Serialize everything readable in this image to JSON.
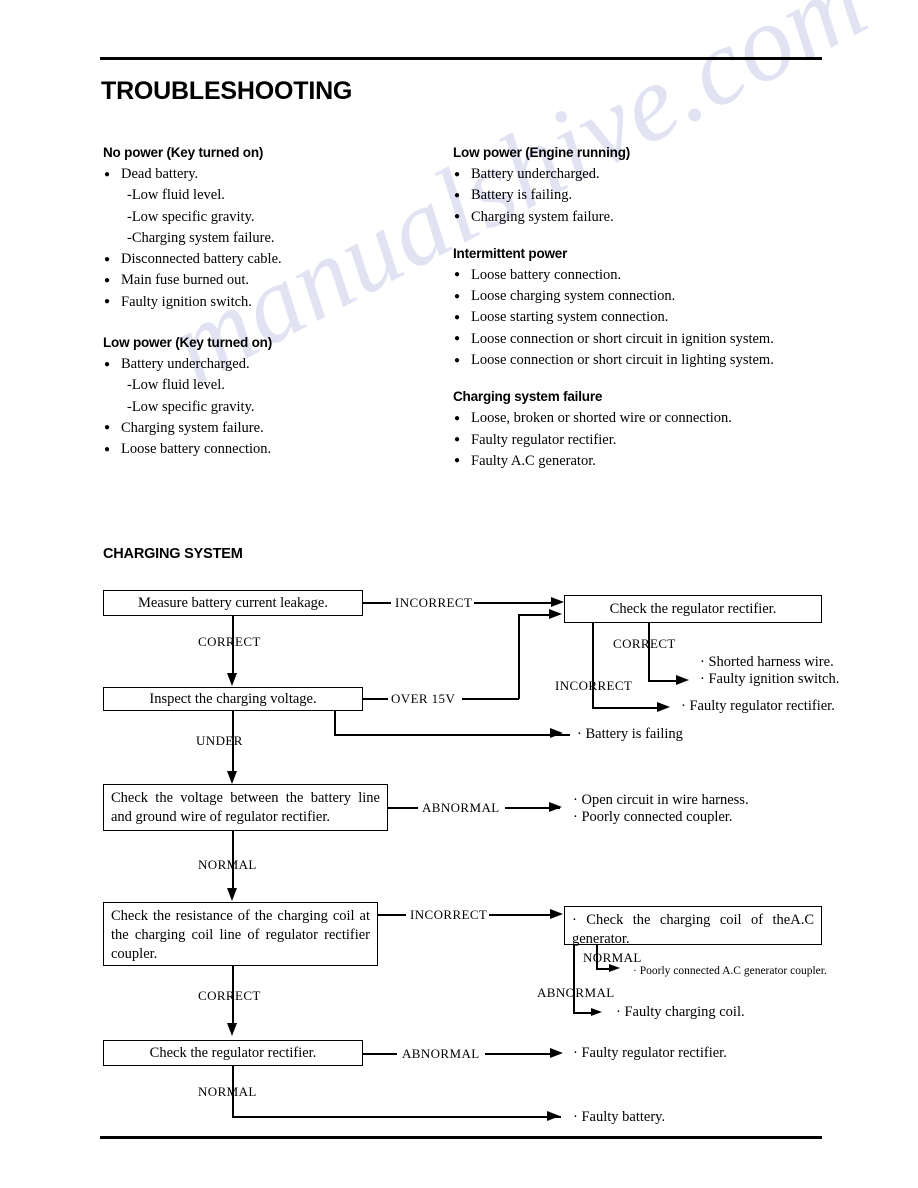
{
  "document": {
    "title": "TROUBLESHOOTING",
    "watermark": "manualshive.com"
  },
  "fault_sections": {
    "left": [
      {
        "heading": "No power (Key turned on)",
        "items": [
          {
            "text": "Dead battery.",
            "style": "bullet"
          },
          {
            "text": "-Low fluid level.",
            "style": "sub"
          },
          {
            "text": "-Low specific gravity.",
            "style": "sub"
          },
          {
            "text": "-Charging system failure.",
            "style": "sub"
          },
          {
            "text": "Disconnected battery cable.",
            "style": "bullet"
          },
          {
            "text": "Main fuse burned out.",
            "style": "bullet"
          },
          {
            "text": "Faulty ignition switch.",
            "style": "bullet"
          }
        ]
      },
      {
        "heading": "Low power (Key turned on)",
        "items": [
          {
            "text": "Battery undercharged.",
            "style": "bullet"
          },
          {
            "text": "-Low fluid level.",
            "style": "sub"
          },
          {
            "text": "-Low specific gravity.",
            "style": "sub"
          },
          {
            "text": "Charging system failure.",
            "style": "bullet"
          },
          {
            "text": "Loose battery connection.",
            "style": "bullet"
          }
        ]
      }
    ],
    "right": [
      {
        "heading": "Low power (Engine running)",
        "items": [
          {
            "text": "Battery undercharged.",
            "style": "bullet"
          },
          {
            "text": "Battery is failing.",
            "style": "bullet"
          },
          {
            "text": "Charging system failure.",
            "style": "bullet"
          }
        ]
      },
      {
        "heading": "Intermittent power",
        "items": [
          {
            "text": "Loose battery connection.",
            "style": "bullet"
          },
          {
            "text": "Loose charging system connection.",
            "style": "bullet"
          },
          {
            "text": "Loose starting system connection.",
            "style": "bullet"
          },
          {
            "text": "Loose connection or short circuit in ignition system.",
            "style": "bullet"
          },
          {
            "text": "Loose connection or short circuit in lighting system.",
            "style": "bullet"
          }
        ]
      },
      {
        "heading": "Charging system failure",
        "items": [
          {
            "text": "Loose, broken or shorted wire or connection.",
            "style": "bullet"
          },
          {
            "text": "Faulty regulator rectifier.",
            "style": "bullet"
          },
          {
            "text": "Faulty A.C generator.",
            "style": "bullet"
          }
        ]
      }
    ]
  },
  "flowchart": {
    "title": "CHARGING SYSTEM",
    "boxes": {
      "measure_leakage": "Measure battery current leakage.",
      "inspect_voltage": "Inspect the charging voltage.",
      "check_regulator_top": "Check the regulator rectifier.",
      "check_voltage_battery_line": "Check the voltage between the battery line and ground wire of regulator rectifier.",
      "check_resistance_coil": "Check the resistance of the charging coil at the charging coil line of regulator rectifier coupler.",
      "check_charging_coil_ac": "Check the charging coil of theA.C generator.",
      "check_regulator_bottom": "Check the regulator rectifier."
    },
    "labels": {
      "incorrect_1": "INCORRECT",
      "correct_1": "CORRECT",
      "over_15v": "OVER 15V",
      "correct_reg": "CORRECT",
      "incorrect_reg": "INCORRECT",
      "under": "UNDER",
      "abnormal_voltage": "ABNORMAL",
      "normal_voltage": "NORMAL",
      "incorrect_coil": "INCORRECT",
      "normal_ac": "NORMAL",
      "abnormal_ac": "ABNORMAL",
      "correct_coil": "CORRECT",
      "abnormal_reg_bottom": "ABNORMAL",
      "normal_reg_bottom": "NORMAL"
    },
    "outcomes": {
      "shorted_harness": "Shorted harness wire.",
      "faulty_ignition_switch": "Faulty ignition switch.",
      "faulty_regulator_rectifier_1": "Faulty regulator rectifier.",
      "battery_is_failing": "Battery is failing",
      "open_circuit": "Open circuit in wire harness.",
      "poorly_connected_coupler": "Poorly connected coupler.",
      "poorly_connected_ac_coupler": "Poorly connected A.C generator coupler.",
      "faulty_charging_coil": "Faulty  charging coil.",
      "faulty_regulator_rectifier_2": "Faulty regulator rectifier.",
      "faulty_battery": "Faulty battery."
    }
  }
}
